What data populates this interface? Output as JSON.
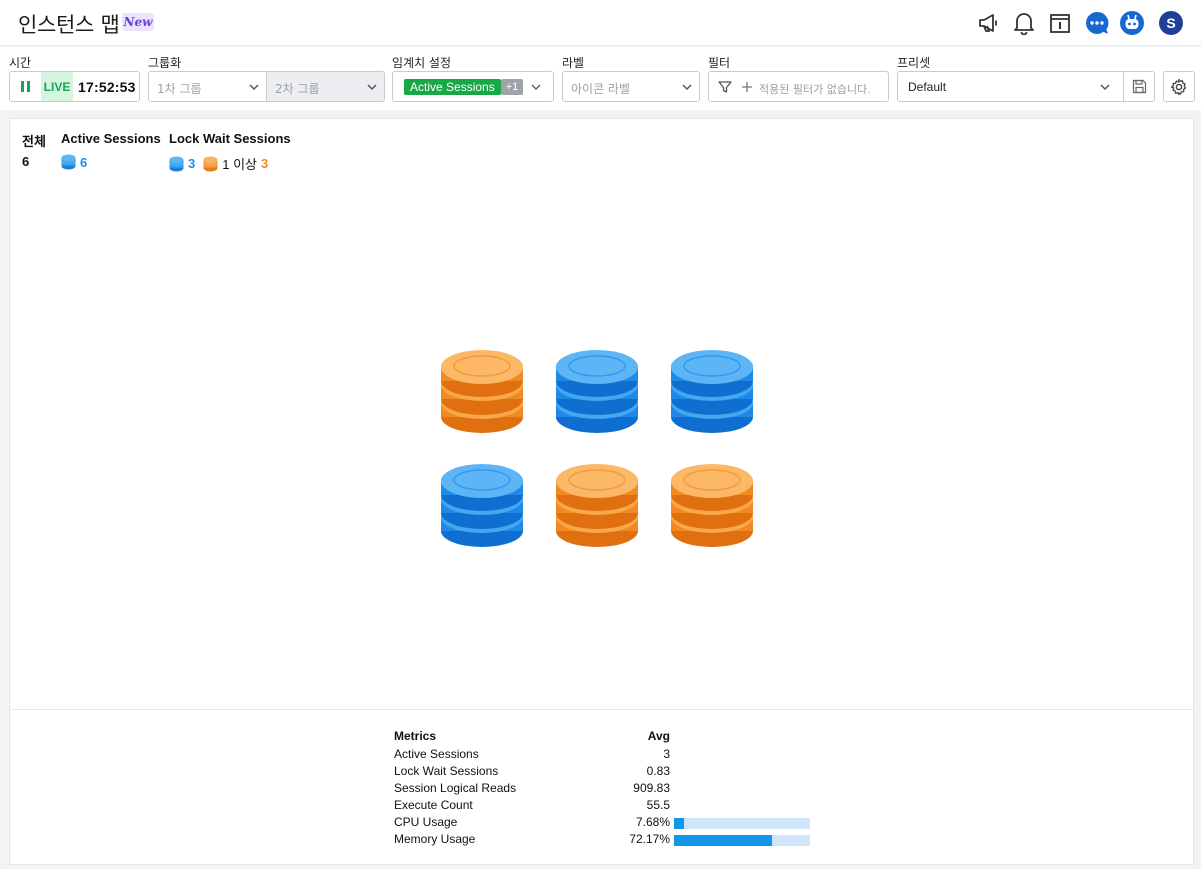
{
  "header": {
    "title": "인스턴스 맵",
    "badge": "New",
    "avatar_letter": "S"
  },
  "toolbar": {
    "time": {
      "label": "시간",
      "live": "LIVE",
      "clock": "17:52:53"
    },
    "grouping": {
      "label": "그룹화",
      "group1_placeholder": "1차 그룹",
      "group2_placeholder": "2차 그룹"
    },
    "threshold": {
      "label": "임계치 설정",
      "chip": "Active Sessions",
      "more": "+1"
    },
    "tag_label": {
      "label": "라벨",
      "placeholder": "아이콘 라벨"
    },
    "filter": {
      "label": "필터",
      "placeholder": "적용된 필터가 없습니다."
    },
    "preset": {
      "label": "프리셋",
      "value": "Default"
    }
  },
  "summary": {
    "total": {
      "label": "전체",
      "value": "6"
    },
    "active": {
      "label": "Active Sessions",
      "value": "6"
    },
    "lock": {
      "label": "Lock Wait Sessions",
      "blue_value": "3",
      "orange_label": "1 이상",
      "orange_value": "3"
    }
  },
  "instances": [
    {
      "status": "orange"
    },
    {
      "status": "blue"
    },
    {
      "status": "blue"
    },
    {
      "status": "blue"
    },
    {
      "status": "orange"
    },
    {
      "status": "orange"
    }
  ],
  "metrics": {
    "header": {
      "name": "Metrics",
      "avg": "Avg"
    },
    "rows": [
      {
        "name": "Active Sessions",
        "avg": "3"
      },
      {
        "name": "Lock Wait Sessions",
        "avg": "0.83"
      },
      {
        "name": "Session Logical Reads",
        "avg": "909.83"
      },
      {
        "name": "Execute Count",
        "avg": "55.5"
      },
      {
        "name": "CPU Usage",
        "avg": "7.68%",
        "bar_fraction": 0.0768
      },
      {
        "name": "Memory Usage",
        "avg": "72.17%",
        "bar_fraction": 0.7217
      }
    ]
  },
  "colors": {
    "blue": "#1e90e8",
    "orange": "#f5962a",
    "live_green": "#18a558",
    "accent_chip": "#18a846"
  }
}
